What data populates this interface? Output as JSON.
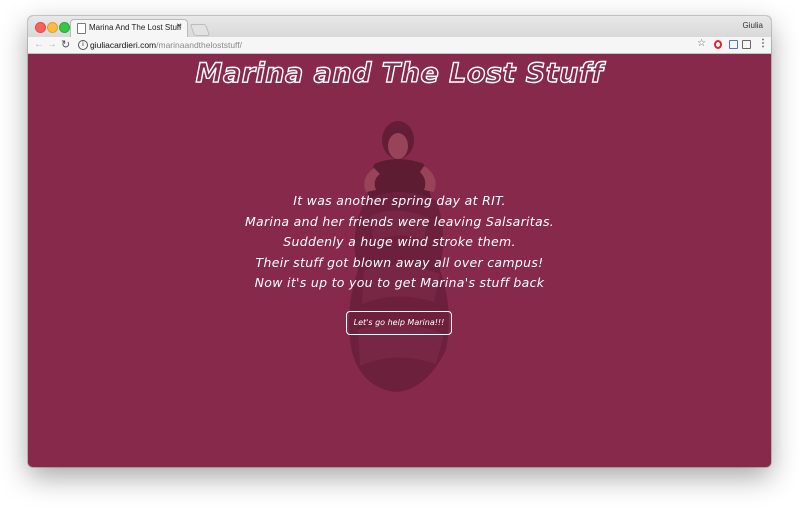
{
  "browser": {
    "tab_title": "Marina And The Lost Stuff",
    "tab_close": "×",
    "profile_name": "Giulia",
    "url_host": "giuliacardieri.com",
    "url_path": "/marinaandtheloststuff/",
    "icons": [
      "back-arrow-icon",
      "forward-arrow-icon",
      "reload-icon",
      "info-icon",
      "star-icon",
      "opera-icon",
      "screenshot-icon",
      "cast-icon",
      "menu-icon"
    ]
  },
  "page": {
    "title": "Marina and The Lost Stuff",
    "story_lines": [
      "It was another spring day at RIT.",
      "Marina and her friends were leaving Salsaritas.",
      "Suddenly a huge wind stroke them.",
      "Their stuff got blown away all over campus!",
      "Now it's up to you to get Marina's stuff back"
    ],
    "button_label": "Let's go help Marina!!!"
  },
  "colors": {
    "background": "#86294a",
    "text": "#ffffff"
  }
}
